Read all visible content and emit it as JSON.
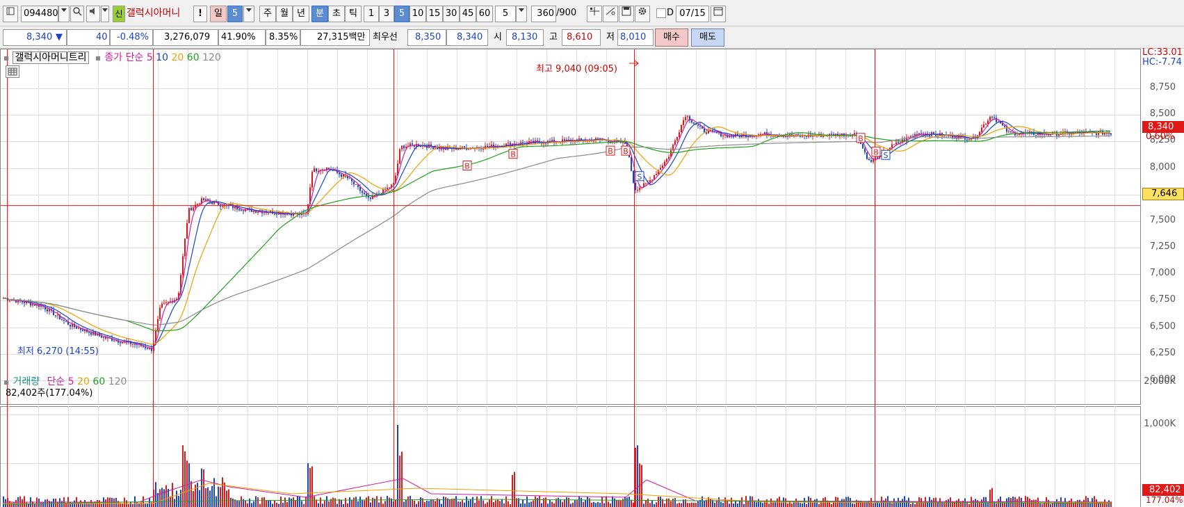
{
  "toolbar": {
    "code": "094480",
    "badge_new": "신",
    "name": "갤럭시아머니",
    "exclaim": "!",
    "period_day": "일",
    "period_value": "5",
    "period_week": "주",
    "period_month": "월",
    "period_year": "년",
    "period_min": "분",
    "period_sec": "초",
    "period_tick": "틱",
    "intervals": [
      "1",
      "3",
      "5",
      "10",
      "15",
      "30",
      "45",
      "60"
    ],
    "interval_select": "5",
    "count": "360",
    "count_total": "/900",
    "d_label": "D",
    "date": "07/15"
  },
  "quote": {
    "price": "8,340",
    "arrow": "▼",
    "change": "40",
    "change_pct": "-0.48%",
    "volume": "3,276,079",
    "vol_ratio": "41.90%",
    "turnover": "8.35%",
    "amount": "27,315백만",
    "best_label": "최우선",
    "best_ask": "8,350",
    "best_bid": "8,340",
    "open_label": "시",
    "open": "8,130",
    "high_label": "고",
    "high": "8,610",
    "low_label": "저",
    "low": "8,010",
    "buy_label": "매수",
    "sell_label": "매도"
  },
  "price_panel": {
    "legend_name": "갤럭시아머니트리",
    "legend_close": "종가",
    "legend_simple": "단순",
    "ma": [
      "5",
      "10",
      "20",
      "60",
      "120"
    ],
    "high_annotation": "최고 9,040 (09:05)",
    "low_annotation": "최저 6,270 (14:55)",
    "lc": "LC:33.01",
    "hc": "HC:-7.74",
    "price_tag": "8,340",
    "pct_tag": "0.60%",
    "crosshair_tag": "7,646",
    "y_ticks": [
      "8,750",
      "8,500",
      "8,250",
      "8,000",
      "7,750",
      "7,500",
      "7,250",
      "7,000",
      "6,750",
      "6,500",
      "6,250",
      "6,000"
    ],
    "markers": [
      "B",
      "B",
      "B",
      "B",
      "S",
      "B",
      "B",
      "S"
    ]
  },
  "volume_panel": {
    "legend_name": "거래량",
    "legend_simple": "단순",
    "ma": [
      "5",
      "20",
      "60",
      "120"
    ],
    "current": "82,402주(177.04%)",
    "y_ticks": [
      "2,000K",
      "1,000K"
    ],
    "vol_tag": "82,402",
    "vol_pct_tag": "177.04%"
  },
  "colors": {
    "up": "#e01818",
    "down": "#1a44c8",
    "ma5": "#d01ca0",
    "ma10": "#1a44c8",
    "ma20": "#f0a000",
    "ma60": "#20a020",
    "ma120": "#8a8a8a",
    "crosshair": "#e01818"
  }
}
